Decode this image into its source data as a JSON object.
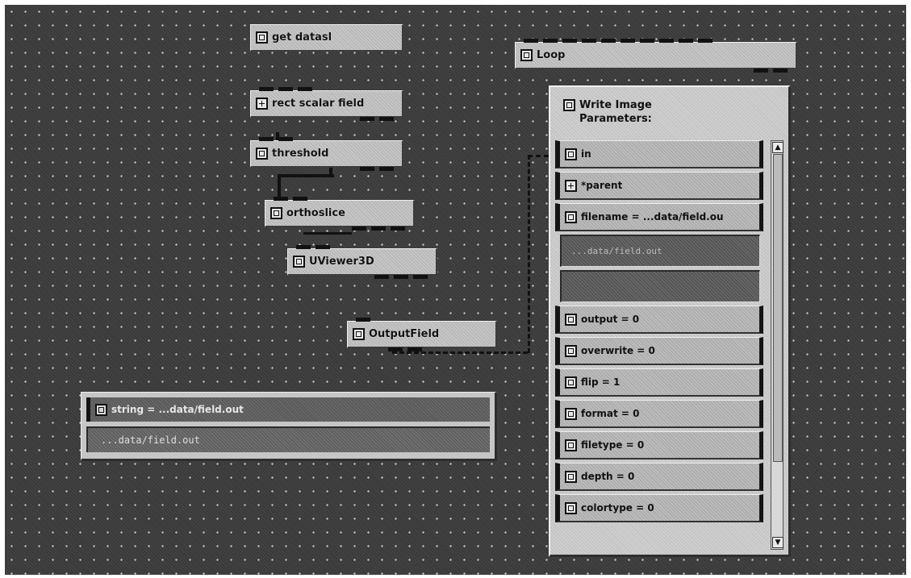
{
  "network": {
    "modules": [
      {
        "label": "get datasl",
        "icon": "module-icon"
      },
      {
        "label": "Loop",
        "icon": "module-icon"
      },
      {
        "label": "rect scalar field",
        "icon": "grid-icon"
      },
      {
        "label": "threshold",
        "icon": "module-icon"
      },
      {
        "label": "orthoslice",
        "icon": "module-icon"
      },
      {
        "label": "UViewer3D",
        "icon": "module-icon"
      },
      {
        "label": "OutputField",
        "icon": "module-icon"
      }
    ]
  },
  "write_image": {
    "title_line1": "Write Image",
    "title_line2": "Parameters:",
    "params": [
      {
        "label": "in",
        "icon": "param-icon"
      },
      {
        "label": "*parent",
        "icon": "grid-icon"
      },
      {
        "label": "filename = ...data/field.ou",
        "icon": "param-icon"
      }
    ],
    "filename_field_value": "...data/field.out",
    "params_lower": [
      {
        "label": "output = 0",
        "icon": "param-icon"
      },
      {
        "label": "overwrite = 0",
        "icon": "param-icon"
      },
      {
        "label": "flip = 1",
        "icon": "param-icon"
      },
      {
        "label": "format = 0",
        "icon": "param-icon"
      },
      {
        "label": "filetype = 0",
        "icon": "param-icon"
      },
      {
        "label": "depth = 0",
        "icon": "param-icon"
      },
      {
        "label": "colortype = 0",
        "icon": "param-icon"
      }
    ]
  },
  "string_module": {
    "header": "string = ...data/field.out",
    "value": "...data/field.out"
  }
}
